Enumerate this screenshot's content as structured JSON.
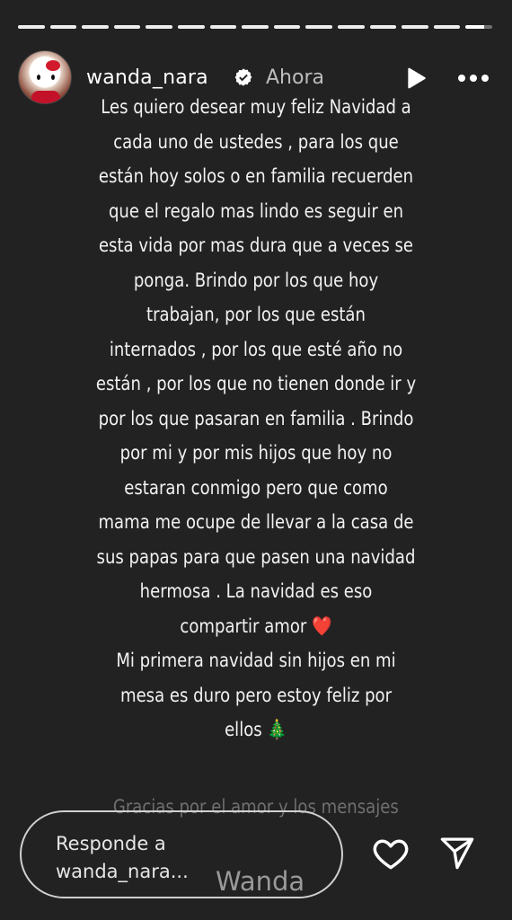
{
  "progress_segments": 15,
  "header": {
    "avatar_alt": "hello-kitty-avatar",
    "username": "wanda_nara",
    "timestamp": "Ahora"
  },
  "story_lines": [
    "Les quiero desear muy  feliz Navidad a",
    "cada  uno de ustedes , para los que",
    "están hoy solos o en familia recuerden",
    "que el regalo mas lindo es seguir en",
    "esta vida por mas dura que a veces se",
    "ponga. Brindo por los que hoy",
    "trabajan, por los que están",
    "internados , por los que esté año no",
    "están , por los que no tienen donde ir y",
    "por los que pasaran en familia . Brindo",
    "por mi y por mis hijos que hoy no",
    "estaran conmigo pero que como",
    "mama me  ocupe  de llevar a la casa de",
    "sus papas para que pasen una navidad",
    "hermosa  . La navidad es eso",
    "compartir  amor ❤️",
    "Mi primera  navidad sin hijos  en mi",
    "mesa es duro  pero  estoy feliz por",
    "ellos 🎄"
  ],
  "faded_line": "Gracias por el amor y los mensajes",
  "reply": {
    "placeholder_line1": "Responde a",
    "placeholder_line2": "wanda_nara..."
  },
  "watermark": "Wanda",
  "colors": {
    "background": "#222223",
    "text": "#f2f2f2",
    "verified_badge": "#ffffff"
  }
}
